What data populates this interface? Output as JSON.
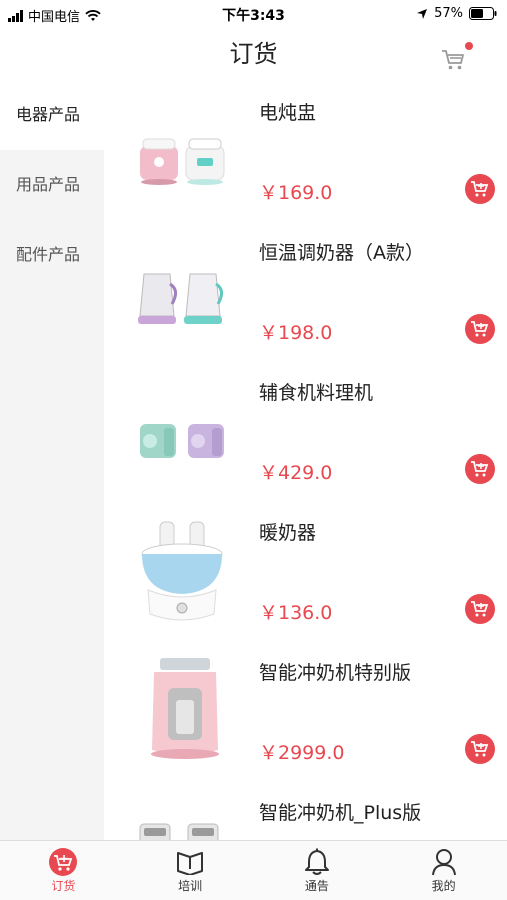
{
  "status_bar": {
    "carrier": "中国电信",
    "time": "下午3:43",
    "battery": "57%"
  },
  "header": {
    "title": "订货",
    "cart_icon": "cart-icon",
    "cart_has_badge": true
  },
  "sidebar": {
    "items": [
      {
        "label": "电器产品",
        "active": true
      },
      {
        "label": "用品产品",
        "active": false
      },
      {
        "label": "配件产品",
        "active": false
      }
    ]
  },
  "products": [
    {
      "name": "电炖盅",
      "price": "￥169.0",
      "image": "stew-pot-image"
    },
    {
      "name": "恒温调奶器（A款）",
      "price": "￥198.0",
      "image": "kettle-image"
    },
    {
      "name": "辅食机料理机",
      "price": "￥429.0",
      "image": "food-processor-image"
    },
    {
      "name": "暖奶器",
      "price": "￥136.0",
      "image": "bottle-warmer-image"
    },
    {
      "name": "智能冲奶机特别版",
      "price": "￥2999.0",
      "image": "formula-maker-image"
    },
    {
      "name": "智能冲奶机_Plus版",
      "price": "",
      "image": "formula-maker-plus-image"
    }
  ],
  "tabbar": {
    "items": [
      {
        "label": "订货",
        "icon": "cart-icon",
        "active": true
      },
      {
        "label": "培训",
        "icon": "book-icon",
        "active": false
      },
      {
        "label": "通告",
        "icon": "bell-icon",
        "active": false
      },
      {
        "label": "我的",
        "icon": "person-icon",
        "active": false
      }
    ]
  },
  "colors": {
    "accent": "#e8484f",
    "sidebar_bg": "#f4f4f4"
  }
}
